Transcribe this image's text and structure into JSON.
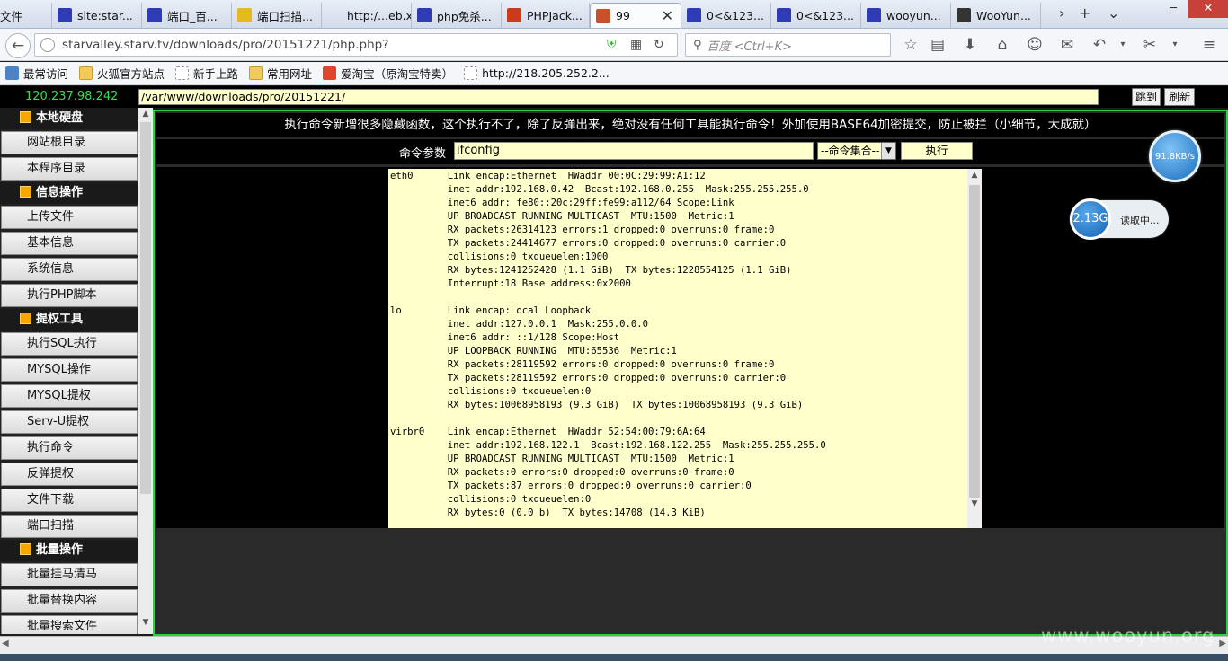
{
  "browser": {
    "tabs": [
      {
        "label": "文件",
        "icon": "file-icon"
      },
      {
        "label": "site:star...",
        "icon": "baidu-paw-icon"
      },
      {
        "label": "端口_百...",
        "icon": "baidu-paw-icon"
      },
      {
        "label": "端口扫描...",
        "icon": "scan-app-icon"
      },
      {
        "label": "http:/...eb.xml",
        "icon": "blank-page-icon"
      },
      {
        "label": "php免杀...",
        "icon": "baidu-paw-icon"
      },
      {
        "label": "PHPJack...",
        "icon": "phpjackal-icon"
      },
      {
        "label": "99",
        "icon": "shield-icon"
      },
      {
        "label": "0<&123...",
        "icon": "baidu-paw-icon"
      },
      {
        "label": "0<&123...",
        "icon": "baidu-paw-icon"
      },
      {
        "label": "wooyun...",
        "icon": "baidu-paw-icon"
      },
      {
        "label": "WooYun...",
        "icon": "wooyun-icon"
      }
    ],
    "active_tab_close": "✕",
    "tab_next": "›",
    "tab_new": "+",
    "tab_list": "⌄",
    "win": {
      "min": "─",
      "max": "❐",
      "close": "✕"
    },
    "url": "starvalley.starv.tv/downloads/pro/20151221/php.php?",
    "search_placeholder": "百度 <Ctrl+K>",
    "bookmarks": [
      {
        "label": "最常访问",
        "icon": "most-visited-icon"
      },
      {
        "label": "火狐官方站点",
        "icon": "folder-icon"
      },
      {
        "label": "新手上路",
        "icon": "page-icon"
      },
      {
        "label": "常用网址",
        "icon": "folder-icon"
      },
      {
        "label": "爱淘宝（原淘宝特卖）",
        "icon": "taobao-icon"
      },
      {
        "label": "http://218.205.252.2...",
        "icon": "page-icon"
      }
    ]
  },
  "shell": {
    "ip": "120.237.98.242",
    "path": "/var/www/downloads/pro/20151221/",
    "jump_btn": "跳到",
    "refresh_btn": "刷新",
    "sidebar": [
      {
        "type": "header",
        "label": "本地硬盘"
      },
      {
        "type": "item",
        "label": "网站根目录"
      },
      {
        "type": "item",
        "label": "本程序目录"
      },
      {
        "type": "header",
        "label": "信息操作"
      },
      {
        "type": "item",
        "label": "上传文件"
      },
      {
        "type": "item",
        "label": "基本信息"
      },
      {
        "type": "item",
        "label": "系统信息"
      },
      {
        "type": "item",
        "label": "执行PHP脚本"
      },
      {
        "type": "header",
        "label": "提权工具"
      },
      {
        "type": "item",
        "label": "执行SQL执行"
      },
      {
        "type": "item",
        "label": "MYSQL操作"
      },
      {
        "type": "item",
        "label": "MYSQL提权"
      },
      {
        "type": "item",
        "label": "Serv-U提权"
      },
      {
        "type": "item",
        "label": "执行命令"
      },
      {
        "type": "item",
        "label": "反弹提权"
      },
      {
        "type": "item",
        "label": "文件下载"
      },
      {
        "type": "item",
        "label": "端口扫描"
      },
      {
        "type": "header",
        "label": "批量操作"
      },
      {
        "type": "item",
        "label": "批量挂马清马"
      },
      {
        "type": "item",
        "label": "批量替换内容"
      },
      {
        "type": "item",
        "label": "批量搜索文件"
      }
    ],
    "notice": "执行命令新增很多隐藏函数，这个执行不了，除了反弹出来，绝对没有任何工具能执行命令！外加使用BASE64加密提交，防止被拦（小细节，大成就）",
    "cmd_label": "命令参数",
    "cmd_value": "ifconfig",
    "cmd_select": "--命令集合--",
    "exec_btn": "执行",
    "output": "eth0      Link encap:Ethernet  HWaddr 00:0C:29:99:A1:12\n          inet addr:192.168.0.42  Bcast:192.168.0.255  Mask:255.255.255.0\n          inet6 addr: fe80::20c:29ff:fe99:a112/64 Scope:Link\n          UP BROADCAST RUNNING MULTICAST  MTU:1500  Metric:1\n          RX packets:26314123 errors:1 dropped:0 overruns:0 frame:0\n          TX packets:24414677 errors:0 dropped:0 overruns:0 carrier:0\n          collisions:0 txqueuelen:1000\n          RX bytes:1241252428 (1.1 GiB)  TX bytes:1228554125 (1.1 GiB)\n          Interrupt:18 Base address:0x2000\n\nlo        Link encap:Local Loopback\n          inet addr:127.0.0.1  Mask:255.0.0.0\n          inet6 addr: ::1/128 Scope:Host\n          UP LOOPBACK RUNNING  MTU:65536  Metric:1\n          RX packets:28119592 errors:0 dropped:0 overruns:0 frame:0\n          TX packets:28119592 errors:0 dropped:0 overruns:0 carrier:0\n          collisions:0 txqueuelen:0\n          RX bytes:10068958193 (9.3 GiB)  TX bytes:10068958193 (9.3 GiB)\n\nvirbr0    Link encap:Ethernet  HWaddr 52:54:00:79:6A:64\n          inet addr:192.168.122.1  Bcast:192.168.122.255  Mask:255.255.255.0\n          UP BROADCAST RUNNING MULTICAST  MTU:1500  Metric:1\n          RX packets:0 errors:0 dropped:0 overruns:0 frame:0\n          TX packets:87 errors:0 dropped:0 overruns:0 carrier:0\n          collisions:0 txqueuelen:0\n          RX bytes:0 (0.0 b)  TX bytes:14708 (14.3 KiB)"
  },
  "widgets": {
    "speed": "91.8KB/s",
    "mem_value": "2.13G",
    "mem_status": "读取中..."
  },
  "watermark": "www.wooyun.org",
  "colors": {
    "accent_green": "#2bd23f",
    "input_bg": "#ffffcc"
  }
}
